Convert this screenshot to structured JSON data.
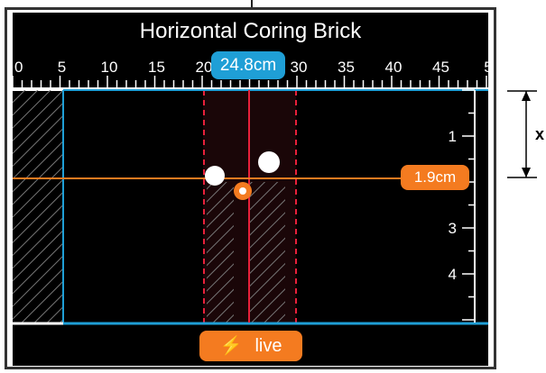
{
  "title": "Horizontal Coring Brick",
  "ruler": {
    "labels": [
      "0",
      "5",
      "10",
      "15",
      "20",
      "25",
      "30",
      "35",
      "40",
      "45",
      "5"
    ],
    "unit": "cm"
  },
  "depth_scale": {
    "labels": [
      "1",
      "2",
      "3",
      "4"
    ]
  },
  "position_readout": "24.8cm",
  "depth_readout": "1.9cm",
  "live_button": {
    "label": "live",
    "icon": "lightning-icon"
  },
  "side_annotation": {
    "label": "x"
  },
  "colors": {
    "blue": "#1f9fd6",
    "orange": "#f47b20",
    "red": "#e8203a",
    "background": "#000000",
    "hatch": "#555555"
  }
}
